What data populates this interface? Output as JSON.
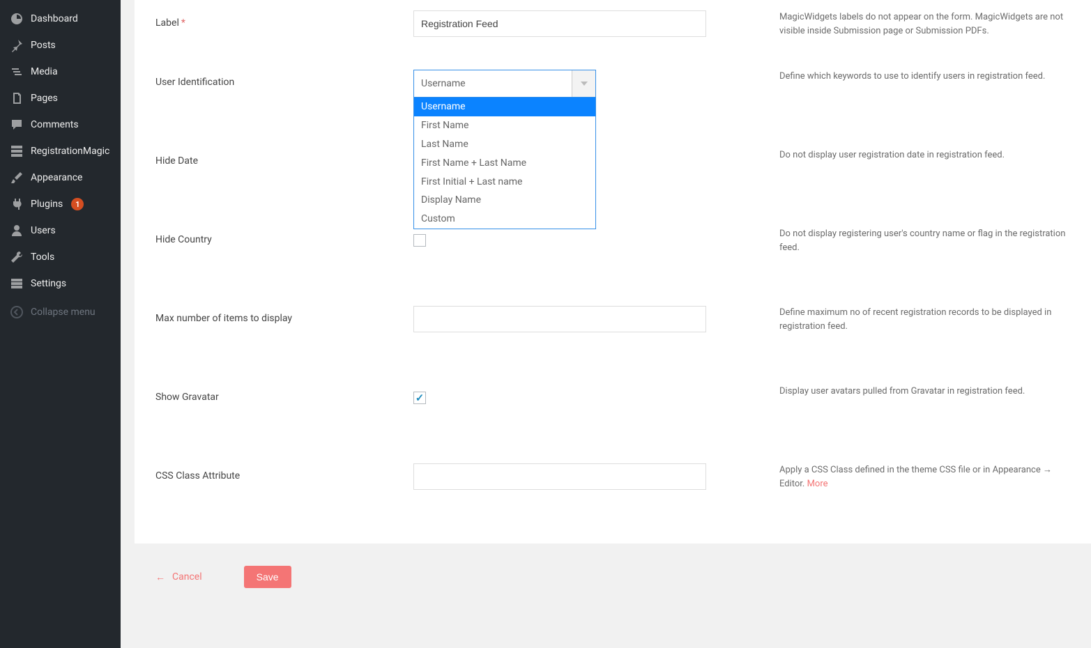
{
  "sidebar": {
    "items": [
      {
        "label": "Dashboard",
        "icon": "dashboard"
      },
      {
        "label": "Posts",
        "icon": "pin"
      },
      {
        "label": "Media",
        "icon": "media"
      },
      {
        "label": "Pages",
        "icon": "pages"
      },
      {
        "label": "Comments",
        "icon": "comment"
      },
      {
        "label": "RegistrationMagic",
        "icon": "grid"
      },
      {
        "label": "Appearance",
        "icon": "brush"
      },
      {
        "label": "Plugins",
        "icon": "plug",
        "badge": "1"
      },
      {
        "label": "Users",
        "icon": "user"
      },
      {
        "label": "Tools",
        "icon": "wrench"
      },
      {
        "label": "Settings",
        "icon": "sliders"
      }
    ],
    "collapse_label": "Collapse menu"
  },
  "form": {
    "label": {
      "text": "Label",
      "value": "Registration Feed",
      "help": "MagicWidgets labels do not appear on the form. MagicWidgets are not visible inside Submission page or Submission PDFs."
    },
    "user_id": {
      "text": "User Identification",
      "selected": "Username",
      "options": [
        "Username",
        "First Name",
        "Last Name",
        "First Name + Last Name",
        "First Initial + Last name",
        "Display Name",
        "Custom"
      ],
      "help": "Define which keywords to use to identify users in registration feed."
    },
    "hide_date": {
      "text": "Hide Date",
      "checked": false,
      "help": "Do not display user registration date in registration feed."
    },
    "hide_country": {
      "text": "Hide Country",
      "checked": false,
      "help": "Do not display registering user's country name or flag in the registration feed."
    },
    "max_items": {
      "text": "Max number of items to display",
      "value": "",
      "help": "Define maximum no of recent registration records to be displayed in registration feed."
    },
    "gravatar": {
      "text": "Show Gravatar",
      "checked": true,
      "help": "Display user avatars pulled from Gravatar in registration feed."
    },
    "css_class": {
      "text": "CSS Class Attribute",
      "value": "",
      "help": "Apply a CSS Class defined in the theme CSS file or in Appearance → Editor. ",
      "more": "More"
    }
  },
  "footer": {
    "cancel": "Cancel",
    "save": "Save"
  }
}
